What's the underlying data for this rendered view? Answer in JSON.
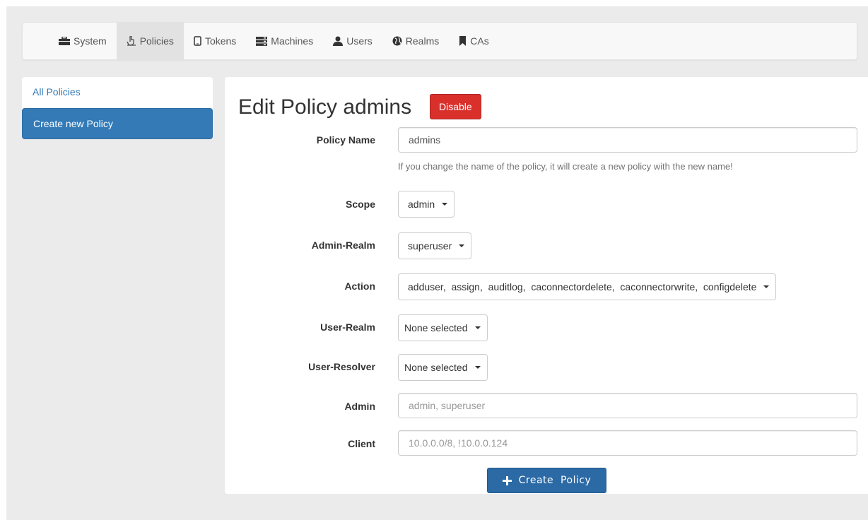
{
  "nav": {
    "items": [
      {
        "label": "System",
        "icon": "briefcase-icon",
        "active": false
      },
      {
        "label": "Policies",
        "icon": "hand-pointer-icon",
        "active": true
      },
      {
        "label": "Tokens",
        "icon": "phone-icon",
        "active": false
      },
      {
        "label": "Machines",
        "icon": "server-icon",
        "active": false
      },
      {
        "label": "Users",
        "icon": "user-icon",
        "active": false
      },
      {
        "label": "Realms",
        "icon": "globe-icon",
        "active": false
      },
      {
        "label": "CAs",
        "icon": "bookmark-icon",
        "active": false
      }
    ]
  },
  "sidebar": {
    "items": [
      {
        "label": "All Policies",
        "active": false
      },
      {
        "label": "Create new Policy",
        "active": true
      }
    ]
  },
  "page": {
    "title": "Edit Policy admins",
    "disable_label": "Disable"
  },
  "form": {
    "policy_name": {
      "label": "Policy Name",
      "value": "admins",
      "help": "If you change the name of the policy, it will create a new policy with the new name!"
    },
    "scope": {
      "label": "Scope",
      "value": "admin"
    },
    "admin_realm": {
      "label": "Admin-Realm",
      "value": "superuser"
    },
    "action": {
      "label": "Action",
      "value": "adduser,  assign,  auditlog,  caconnectordelete,  caconnectorwrite,  configdelete"
    },
    "user_realm": {
      "label": "User-Realm",
      "value": "None selected"
    },
    "user_resolver": {
      "label": "User-Resolver",
      "value": "None selected"
    },
    "admin": {
      "label": "Admin",
      "placeholder": "admin, superuser"
    },
    "client": {
      "label": "Client",
      "placeholder": "10.0.0.0/8, !10.0.0.124"
    },
    "create_label": "Create  Policy"
  },
  "colors": {
    "primary": "#337ab7",
    "danger": "#d9302c",
    "create_button": "#2c6aa5"
  }
}
